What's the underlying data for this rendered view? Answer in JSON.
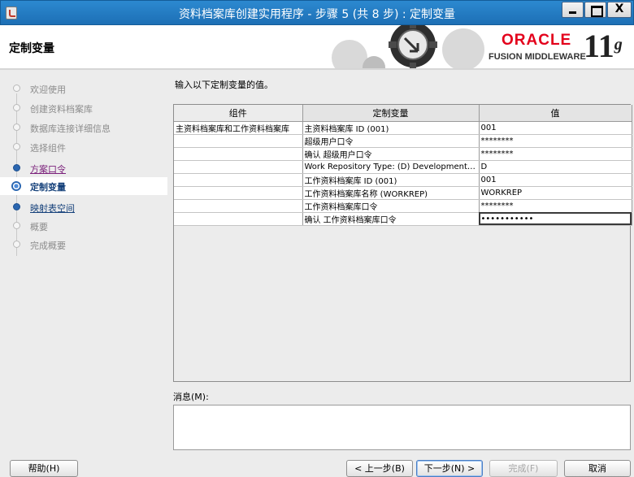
{
  "window": {
    "title": "资料档案库创建实用程序 - 步骤 5 (共 8 步) : 定制变量",
    "close_glyph": "X"
  },
  "header": {
    "page_title": "定制变量",
    "brand_name": "ORACLE",
    "brand_product": "FUSION MIDDLEWARE",
    "brand_version": "11",
    "brand_version_suffix": "g",
    "brand_color": "#e3001b"
  },
  "steps": [
    {
      "label": "欢迎使用",
      "state": "done"
    },
    {
      "label": "创建资料档案库",
      "state": "done"
    },
    {
      "label": "数据库连接详细信息",
      "state": "done"
    },
    {
      "label": "选择组件",
      "state": "done"
    },
    {
      "label": "方案口令",
      "state": "visited"
    },
    {
      "label": "定制变量",
      "state": "current"
    },
    {
      "label": "映射表空间",
      "state": "next"
    },
    {
      "label": "概要",
      "state": "pending"
    },
    {
      "label": "完成概要",
      "state": "pending"
    }
  ],
  "main": {
    "instruction": "输入以下定制变量的值。",
    "columns": [
      "组件",
      "定制变量",
      "值"
    ],
    "rows": [
      [
        "主资料档案库和工作资料档案库",
        "主资料档案库 ID (001)",
        "001"
      ],
      [
        "",
        "超级用户口令",
        "********"
      ],
      [
        "",
        "确认 超级用户口令",
        "********"
      ],
      [
        "",
        "Work Repository Type: (D) Development (...",
        "D"
      ],
      [
        "",
        "工作资料档案库 ID (001)",
        "001"
      ],
      [
        "",
        "工作资料档案库名称 (WORKREP)",
        "WORKREP"
      ],
      [
        "",
        "工作资料档案库口令",
        "********"
      ],
      [
        "",
        "确认 工作资料档案库口令",
        "•••••••••••"
      ]
    ],
    "messages_label": "消息(M):"
  },
  "footer": {
    "help": "帮助(H)",
    "back": "< 上一步(B)",
    "next": "下一步(N) >",
    "finish": "完成(F)",
    "cancel": "取消"
  }
}
